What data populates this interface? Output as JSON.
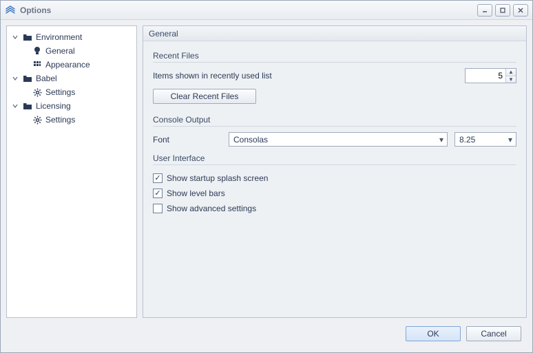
{
  "window": {
    "title": "Options"
  },
  "tree": {
    "environment": {
      "label": "Environment",
      "general": "General",
      "appearance": "Appearance"
    },
    "babel": {
      "label": "Babel",
      "settings": "Settings"
    },
    "licensing": {
      "label": "Licensing",
      "settings": "Settings"
    }
  },
  "page": {
    "header": "General",
    "recent": {
      "title": "Recent Files",
      "items_label": "Items shown in recently used list",
      "items_value": "5",
      "clear_btn": "Clear Recent Files"
    },
    "console": {
      "title": "Console Output",
      "font_label": "Font",
      "font_value": "Consolas",
      "size_value": "8.25"
    },
    "ui": {
      "title": "User Interface",
      "splash": "Show startup splash screen",
      "levelbars": "Show level bars",
      "advanced": "Show advanced settings"
    }
  },
  "footer": {
    "ok": "OK",
    "cancel": "Cancel"
  }
}
